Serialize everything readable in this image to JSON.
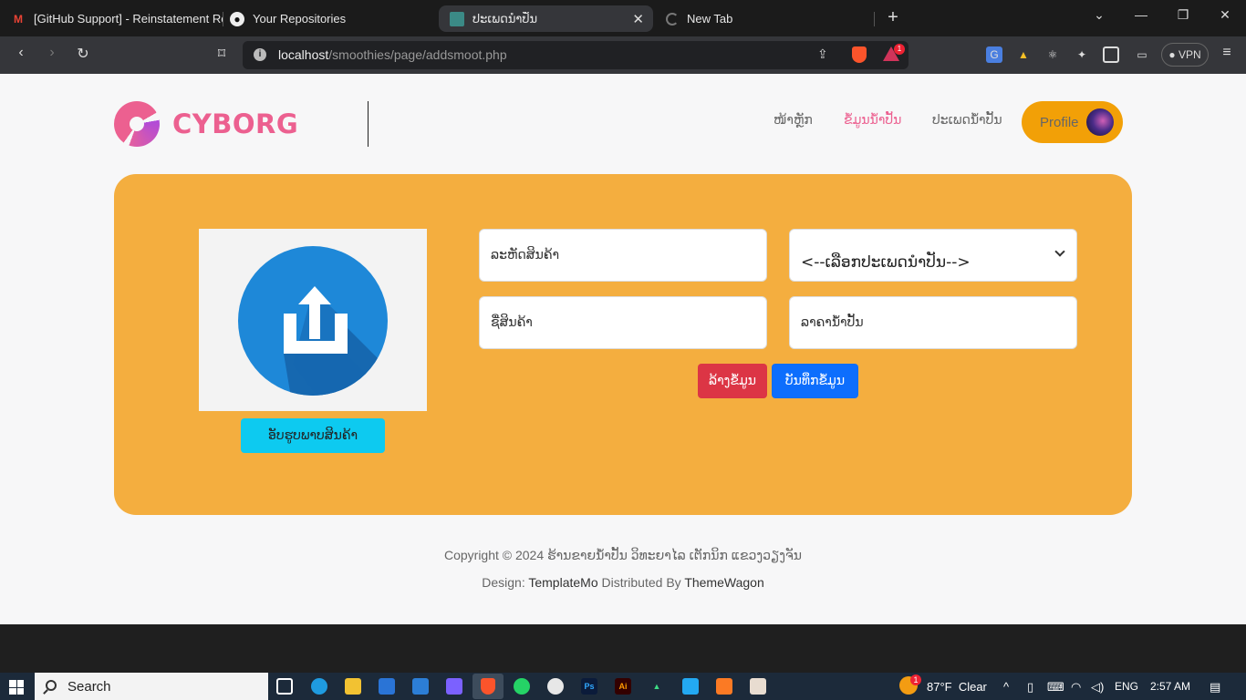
{
  "browser": {
    "tabs": [
      {
        "title": "[GitHub Support] - Reinstatement Re",
        "icon": "gmail-icon"
      },
      {
        "title": "Your Repositories",
        "icon": "github-icon"
      },
      {
        "title": "ປະເພດນຳປັ່ນ",
        "icon": "site-favicon",
        "active": true
      },
      {
        "title": "New Tab",
        "icon": "loading-icon"
      }
    ],
    "url_host": "localhost",
    "url_path": "/smoothies/page/addsmoot.php",
    "rewards_badge": "1",
    "vpn_label": "VPN"
  },
  "site": {
    "logo_text": "CYBORG",
    "nav": [
      {
        "label": "ໜ້າຫຼັກ",
        "active": false
      },
      {
        "label": "ຂໍ້ມູນນ້ຳປັ້ນ",
        "active": true
      },
      {
        "label": "ປະເພດນ້ຳປັ້ນ",
        "active": false
      }
    ],
    "profile_label": "Profile"
  },
  "form": {
    "upload_button": "ອັບຮູບພາບສິນຄ້າ",
    "product_code_placeholder": "ລະຫັດສິນຄ້າ",
    "type_select_value": "<--ເລືອກປະເພດນຳປັນ-->",
    "product_name_placeholder": "ຊື່ສິນຄ້າ",
    "price_placeholder": "ລາຄານ້ຳປັ້ນ",
    "clear_button": "ລ້າງຂໍ້ມູນ",
    "save_button": "ບັນທຶກຂໍ້ມູນ"
  },
  "footer": {
    "copyright": "Copyright © 2024 ຮ້ານຂາຍນ້ຳປັ້ນ ວິທະຍາໄລ ເຕັກນິກ ແຂວງວຽງຈັນ",
    "design_prefix": "Design:",
    "design_link": "TemplateMo",
    "distributed_prefix": "Distributed By",
    "distributed_link": "ThemeWagon"
  },
  "taskbar": {
    "search_label": "Search",
    "weather": "87°F  Clear",
    "language": "ENG",
    "time": "2:57 AM",
    "weather_badge": "1"
  },
  "colors": {
    "accent": "#ec6090",
    "panel": "#f4ae3f",
    "profile": "#f2a007",
    "upload_btn": "#0dcaf0",
    "clear_btn": "#dc3545",
    "save_btn": "#0d6efd"
  }
}
